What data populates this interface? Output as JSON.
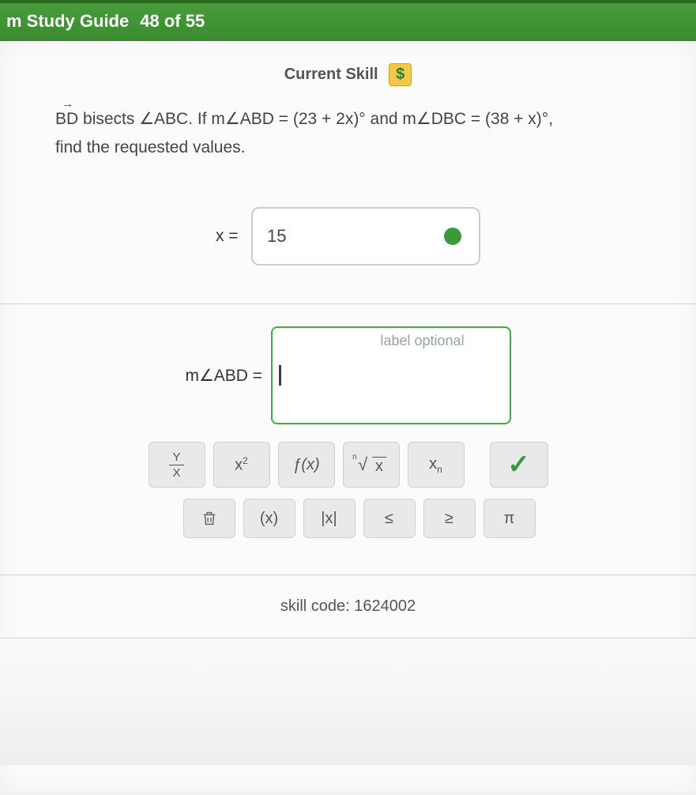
{
  "header": {
    "title": "m Study Guide",
    "progress": "48 of 55"
  },
  "current_skill": {
    "label": "Current Skill",
    "badge": "$"
  },
  "problem": {
    "ray": "BD",
    "line1a": " bisects ",
    "angle1": "∠ABC",
    "line1b": ". If m",
    "angle2": "∠ABD",
    "line1c": " = (23 + 2x)° and m",
    "angle3": "∠DBC",
    "line1d": " = (38 + x)°,",
    "line2": "find the requested values."
  },
  "inputs": {
    "x_label": "x =",
    "x_value": "15",
    "abd_label": "m∠ABD =",
    "abd_value": "",
    "abd_placeholder": "label optional"
  },
  "toolbar": {
    "fraction_top": "Y",
    "fraction_bottom": "X",
    "power": "x",
    "power_sup": "2",
    "func": "ƒ(x)",
    "root_deg": "n",
    "root_rad": "x",
    "subscript_base": "x",
    "subscript_sub": "n",
    "check": "✓",
    "paren": "(x)",
    "abs": "|x|",
    "le": "≤",
    "ge": "≥",
    "pi": "π"
  },
  "skill_code": {
    "label": "skill code: ",
    "value": "1624002"
  }
}
